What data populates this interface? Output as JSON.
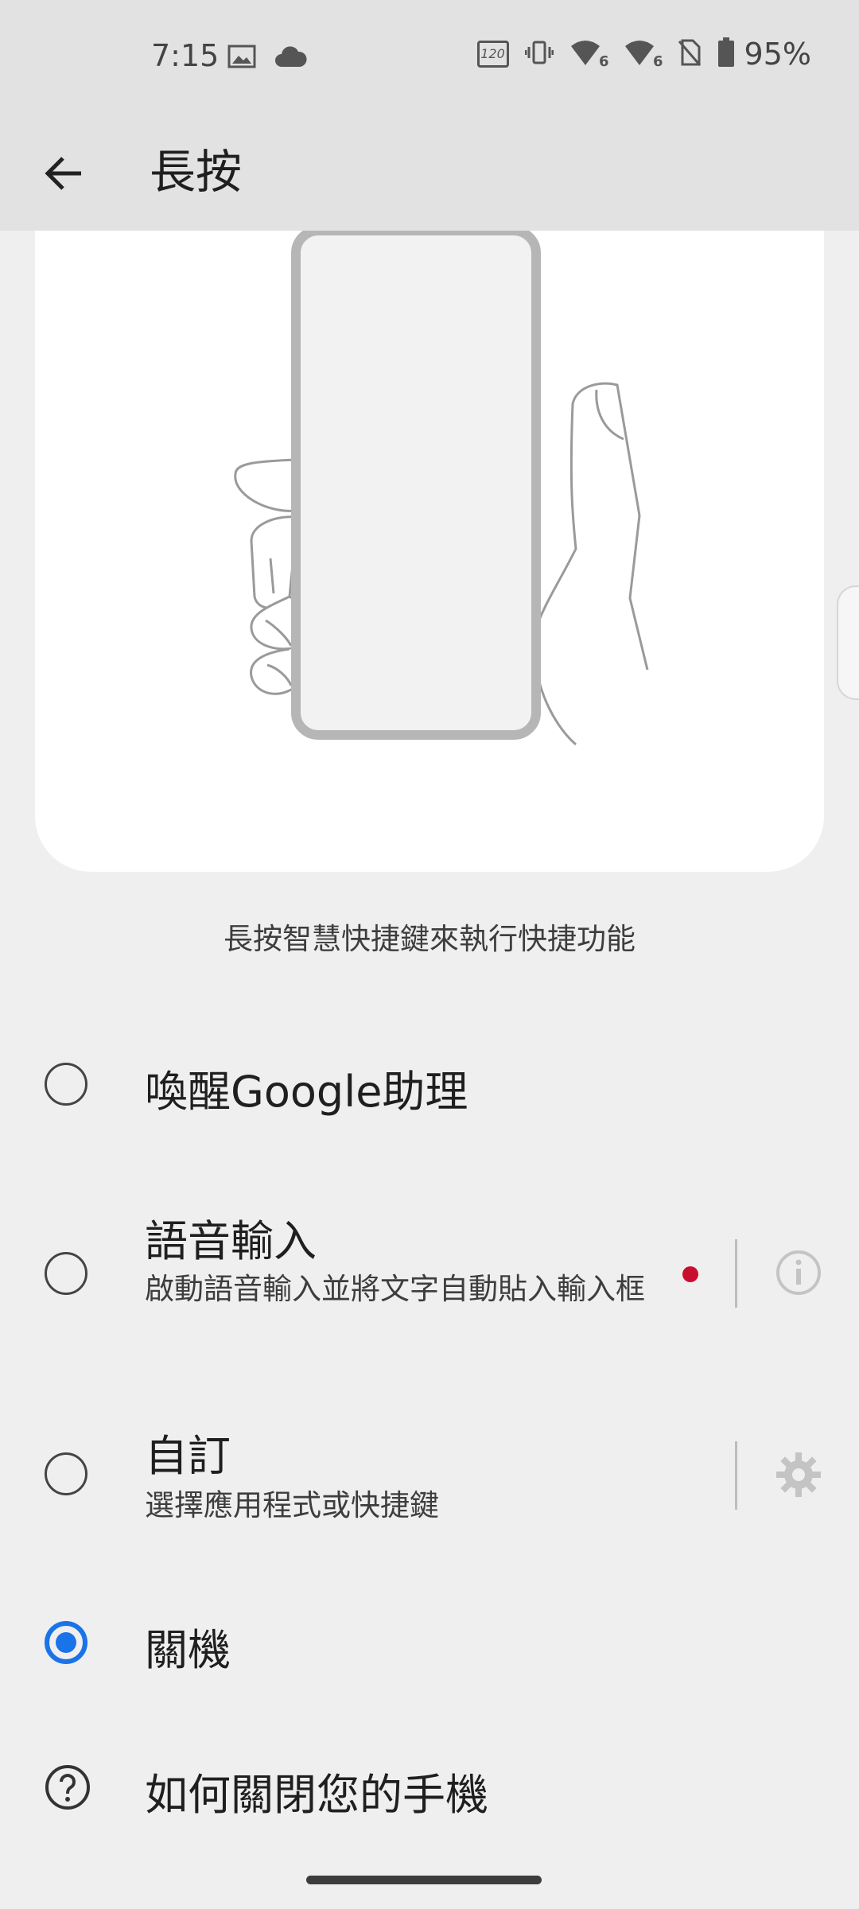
{
  "status_bar": {
    "time": "7:15",
    "refresh_badge": "120",
    "net_badge_1": "6",
    "net_badge_2": "6",
    "battery": "95%"
  },
  "app_bar": {
    "title": "長按"
  },
  "description": "長按智慧快捷鍵來執行快捷功能",
  "options": [
    {
      "title": "喚醒Google助理",
      "subtitle": "",
      "selected": false
    },
    {
      "title": "語音輸入",
      "subtitle": "啟動語音輸入並將文字自動貼入輸入框",
      "selected": false
    },
    {
      "title": "自訂",
      "subtitle": "選擇應用程式或快捷鍵",
      "selected": false
    },
    {
      "title": "關機",
      "subtitle": "",
      "selected": true
    }
  ],
  "help": {
    "title": "如何關閉您的手機"
  },
  "colors": {
    "accent": "#1a73e8",
    "indicator": "#c8102e"
  }
}
